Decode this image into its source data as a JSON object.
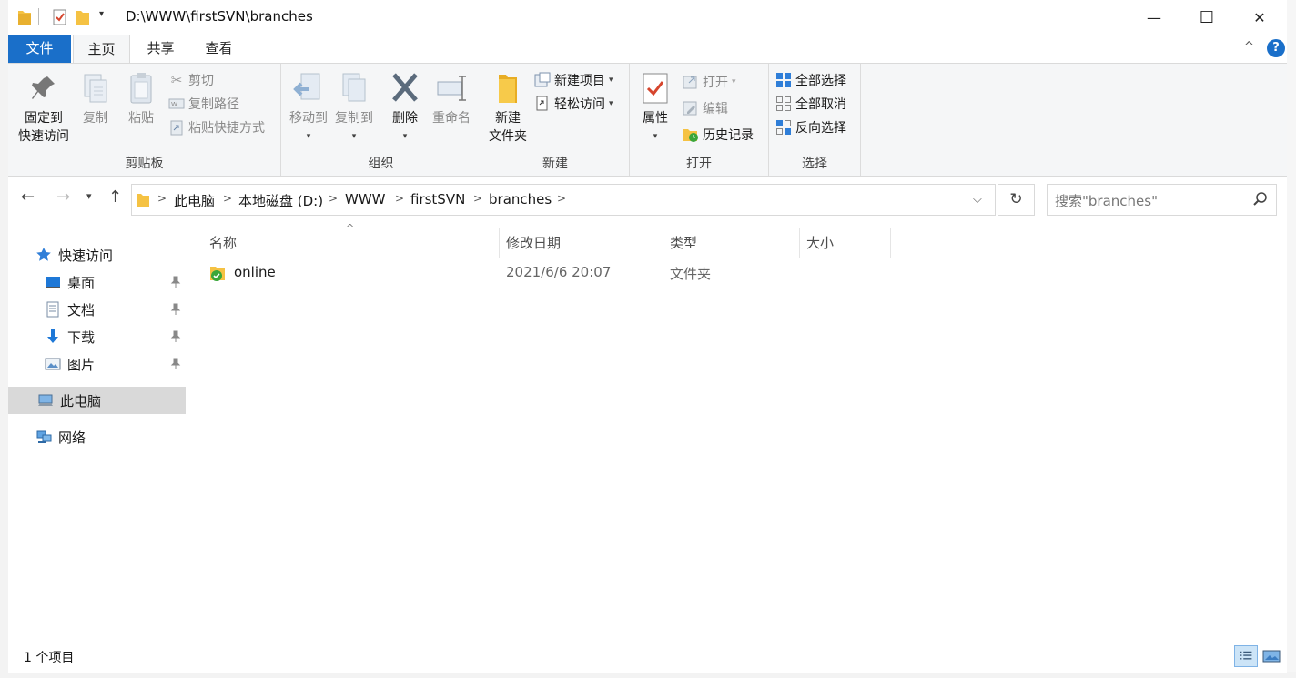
{
  "window": {
    "title": "D:\\WWW\\firstSVN\\branches",
    "minimize_glyph": "—",
    "maximize_glyph": "☐",
    "close_glyph": "✕"
  },
  "ribbon_tabs": {
    "file": "文件",
    "home": "主页",
    "share": "共享",
    "view": "查看",
    "help": "?"
  },
  "ribbon": {
    "clipboard": {
      "label": "剪贴板",
      "pin_line1": "固定到",
      "pin_line2": "快速访问",
      "copy": "复制",
      "paste": "粘贴",
      "cut": "剪切",
      "copy_path": "复制路径",
      "paste_shortcut": "粘贴快捷方式"
    },
    "organize": {
      "label": "组织",
      "move_to": "移动到",
      "copy_to": "复制到",
      "delete": "删除",
      "rename": "重命名"
    },
    "new": {
      "label": "新建",
      "new_folder_line1": "新建",
      "new_folder_line2": "文件夹",
      "new_item": "新建项目",
      "easy_access": "轻松访问"
    },
    "open": {
      "label": "打开",
      "properties": "属性",
      "open": "打开",
      "edit": "编辑",
      "history": "历史记录"
    },
    "select": {
      "label": "选择",
      "select_all": "全部选择",
      "select_none": "全部取消",
      "invert": "反向选择"
    }
  },
  "address": {
    "crumbs": [
      "此电脑",
      "本地磁盘 (D:)",
      "WWW",
      "firstSVN",
      "branches"
    ],
    "search_placeholder": "搜索\"branches\""
  },
  "nav_pane": {
    "quick_access": "快速访问",
    "items": [
      "桌面",
      "文档",
      "下载",
      "图片"
    ],
    "this_pc": "此电脑",
    "network": "网络"
  },
  "columns": {
    "name": "名称",
    "modified": "修改日期",
    "type": "类型",
    "size": "大小"
  },
  "files": [
    {
      "name": "online",
      "modified": "2021/6/6 20:07",
      "type": "文件夹",
      "size": ""
    }
  ],
  "status": {
    "count": "1 个项目"
  },
  "colors": {
    "accent": "#1a6fc9",
    "ribbon_bg": "#f5f6f7",
    "selected_nav": "#d9d9d9",
    "folder_yellow": "#f5c243",
    "svn_green": "#3aa63a"
  }
}
